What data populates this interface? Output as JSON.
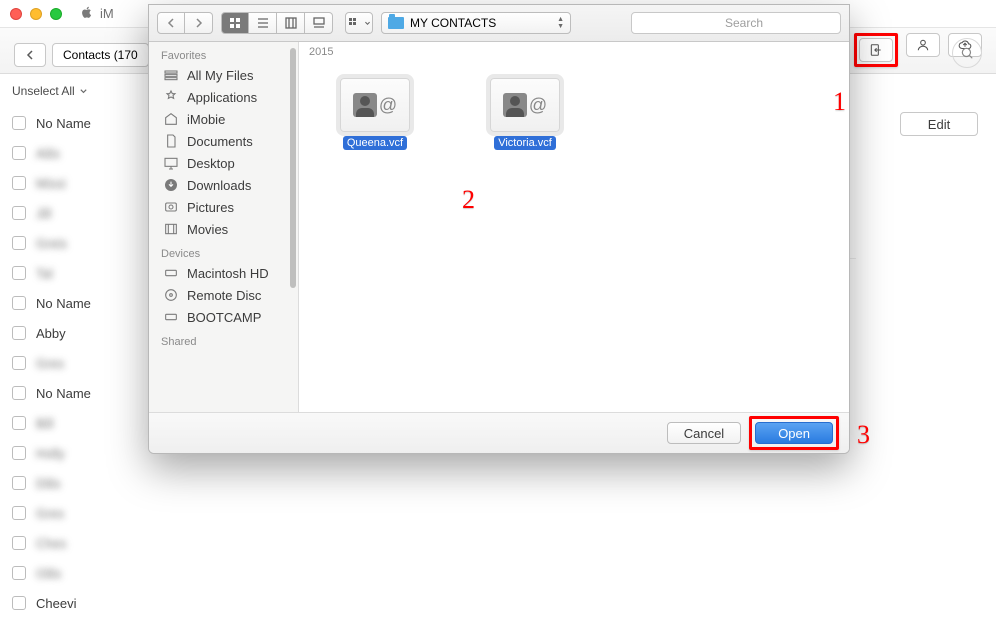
{
  "os": {
    "app_title": "iM"
  },
  "background_window": {
    "nav_title": "Contacts (170",
    "unselect_label": "Unselect All",
    "edit_label": "Edit",
    "contacts": [
      {
        "name": "No Name",
        "blur": false
      },
      {
        "name": "Ailis",
        "blur": true
      },
      {
        "name": "Missi",
        "blur": true
      },
      {
        "name": "Jill",
        "blur": true
      },
      {
        "name": "Greis",
        "blur": true
      },
      {
        "name": "Tal",
        "blur": true
      },
      {
        "name": "No Name",
        "blur": false
      },
      {
        "name": "Abby",
        "blur": false
      },
      {
        "name": "Gres",
        "blur": true
      },
      {
        "name": "No Name",
        "blur": false
      },
      {
        "name": "Bill",
        "blur": true
      },
      {
        "name": "Holly",
        "blur": true
      },
      {
        "name": "Dilis",
        "blur": true
      },
      {
        "name": "Gres",
        "blur": true
      },
      {
        "name": "Ches",
        "blur": true
      },
      {
        "name": "Oilis",
        "blur": true
      },
      {
        "name": "Cheevi",
        "blur": false
      }
    ]
  },
  "dialog": {
    "folder_label": "MY CONTACTS",
    "search_placeholder": "Search",
    "path_header": "2015",
    "sidebar": {
      "section1": "Favorites",
      "favorites": [
        "All My Files",
        "Applications",
        "iMobie",
        "Documents",
        "Desktop",
        "Downloads",
        "Pictures",
        "Movies"
      ],
      "section2": "Devices",
      "devices": [
        "Macintosh HD",
        "Remote Disc",
        "BOOTCAMP"
      ],
      "section3": "Shared"
    },
    "files": [
      {
        "name": "Queena.vcf"
      },
      {
        "name": "Victoria.vcf"
      }
    ],
    "cancel_label": "Cancel",
    "open_label": "Open"
  },
  "annotations": {
    "n1": "1",
    "n2": "2",
    "n3": "3"
  }
}
